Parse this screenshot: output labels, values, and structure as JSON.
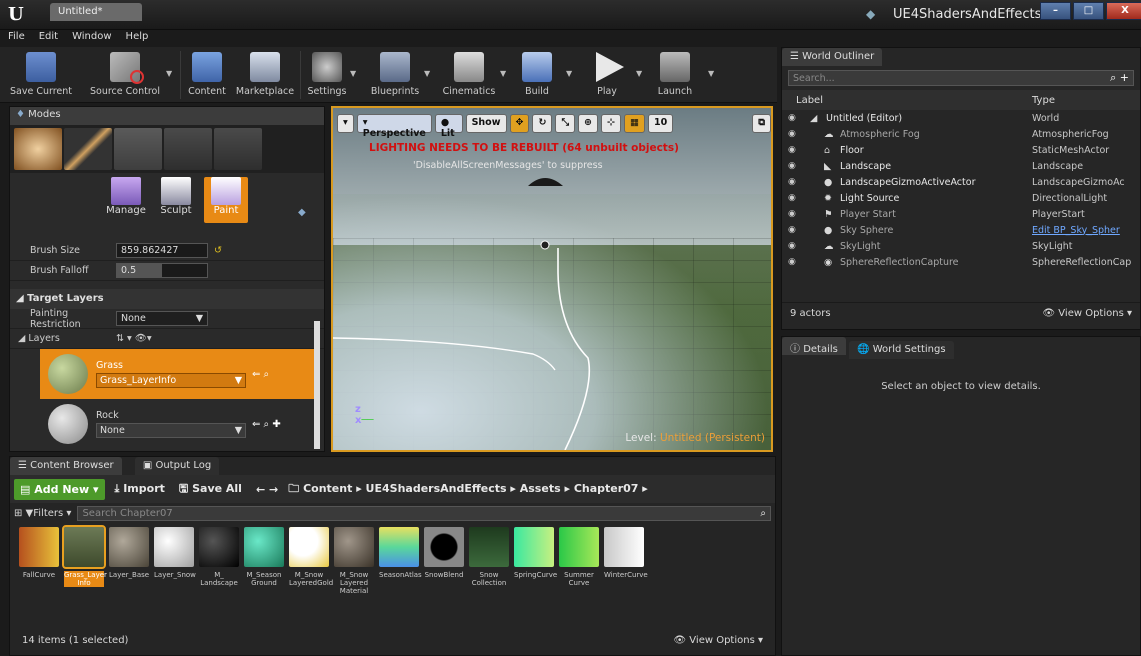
{
  "window": {
    "logo": "U",
    "doc_tab": "Untitled*",
    "project": "UE4ShadersAndEffects",
    "minimize": "–",
    "maximize": "□",
    "close": "X"
  },
  "menu": [
    "File",
    "Edit",
    "Window",
    "Help"
  ],
  "toolbar": [
    "Save Current",
    "Source Control",
    "Content",
    "Marketplace",
    "Settings",
    "Blueprints",
    "Cinematics",
    "Build",
    "Play",
    "Launch"
  ],
  "modes": {
    "tab": "Modes",
    "subtools": [
      "Manage",
      "Sculpt",
      "Paint"
    ],
    "brush_size_label": "Brush Size",
    "brush_size": "859.862427",
    "brush_falloff_label": "Brush Falloff",
    "brush_falloff": "0.5",
    "target_layers": "Target Layers",
    "painting_restriction_label": "Painting Restriction",
    "painting_restriction": "None",
    "layers_label": "Layers",
    "layers": [
      {
        "name": "Grass",
        "info": "Grass_LayerInfo"
      },
      {
        "name": "Rock",
        "info": "None"
      }
    ]
  },
  "viewport": {
    "perspective": "Perspective",
    "lit": "Lit",
    "show": "Show",
    "grid_size": "10",
    "warning": "LIGHTING NEEDS TO BE REBUILT (64 unbuilt objects)",
    "hint": "'DisableAllScreenMessages' to suppress",
    "level_prefix": "Level:",
    "level_name": "Untitled (Persistent)"
  },
  "outliner": {
    "tab": "World Outliner",
    "search_placeholder": "Search...",
    "col_label": "Label",
    "col_type": "Type",
    "rows": [
      {
        "label": "Untitled (Editor)",
        "type": "World"
      },
      {
        "label": "Atmospheric Fog",
        "type": "AtmosphericFog"
      },
      {
        "label": "Floor",
        "type": "StaticMeshActor"
      },
      {
        "label": "Landscape",
        "type": "Landscape"
      },
      {
        "label": "LandscapeGizmoActiveActor",
        "type": "LandscapeGizmoAc"
      },
      {
        "label": "Light Source",
        "type": "DirectionalLight"
      },
      {
        "label": "Player Start",
        "type": "PlayerStart"
      },
      {
        "label": "Sky Sphere",
        "type": "Edit BP_Sky_Spher"
      },
      {
        "label": "SkyLight",
        "type": "SkyLight"
      },
      {
        "label": "SphereReflectionCapture",
        "type": "SphereReflectionCap"
      }
    ],
    "count": "9 actors",
    "view_options": "View Options"
  },
  "details": {
    "tab1": "Details",
    "tab2": "World Settings",
    "message": "Select an object to view details."
  },
  "content_browser": {
    "tab1": "Content Browser",
    "tab2": "Output Log",
    "add_new": "Add New",
    "import": "Import",
    "save_all": "Save All",
    "path": [
      "Content",
      "UE4ShadersAndEffects",
      "Assets",
      "Chapter07"
    ],
    "filters": "Filters",
    "search_placeholder": "Search Chapter07",
    "assets": [
      "FallCurve",
      "Grass_Layer Info",
      "Layer_Base",
      "Layer_Snow",
      "M_ Landscape",
      "M_Season Ground",
      "M_Snow LayeredGold",
      "M_Snow Layered Material",
      "SeasonAtlas",
      "SnowBlend",
      "Snow Collection",
      "SpringCurve",
      "Summer Curve",
      "WinterCurve"
    ],
    "status": "14 items (1 selected)",
    "view_options": "View Options"
  }
}
